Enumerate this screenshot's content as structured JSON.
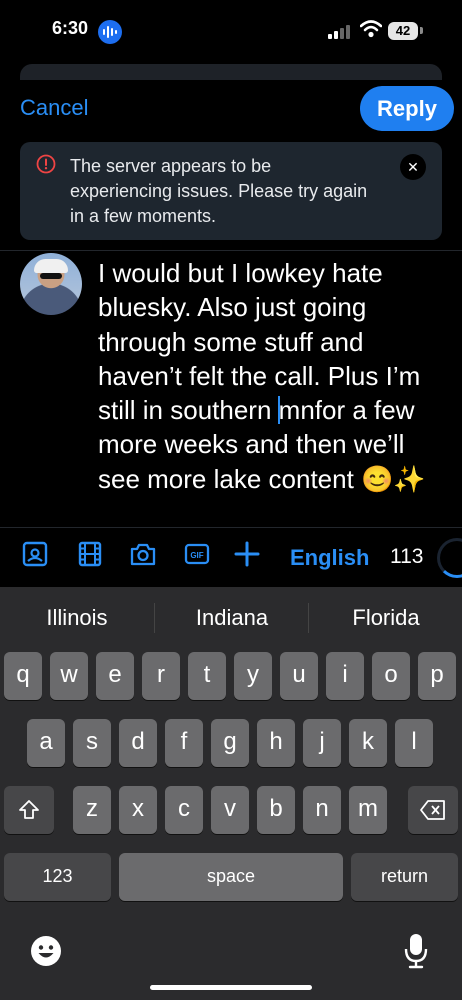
{
  "status_bar": {
    "time": "6:30",
    "battery": "42"
  },
  "header": {
    "cancel_label": "Cancel",
    "reply_label": "Reply"
  },
  "banner": {
    "message": "The server appears to be experiencing issues. Please try again in a few moments."
  },
  "post": {
    "text_before_cursor": "I would but I lowkey hate bluesky. Also just going through some stuff and haven’t felt the call. Plus I’m still in southern ",
    "text_after_cursor": "mnfor a few more weeks and then we’ll see more lake content 😊✨"
  },
  "toolbar": {
    "icons": [
      "image-icon",
      "video-icon",
      "camera-icon",
      "gif-icon",
      "plus-icon"
    ],
    "gif_label": "GIF",
    "language": "English",
    "char_count": "113",
    "accent": "#2a8ef5"
  },
  "keyboard": {
    "suggestions": [
      "Illinois",
      "Indiana",
      "Florida"
    ],
    "row1": [
      "q",
      "w",
      "e",
      "r",
      "t",
      "y",
      "u",
      "i",
      "o",
      "p"
    ],
    "row2": [
      "a",
      "s",
      "d",
      "f",
      "g",
      "h",
      "j",
      "k",
      "l"
    ],
    "row3": [
      "z",
      "x",
      "c",
      "v",
      "b",
      "n",
      "m"
    ],
    "numbers_label": "123",
    "space_label": "space",
    "return_label": "return"
  }
}
